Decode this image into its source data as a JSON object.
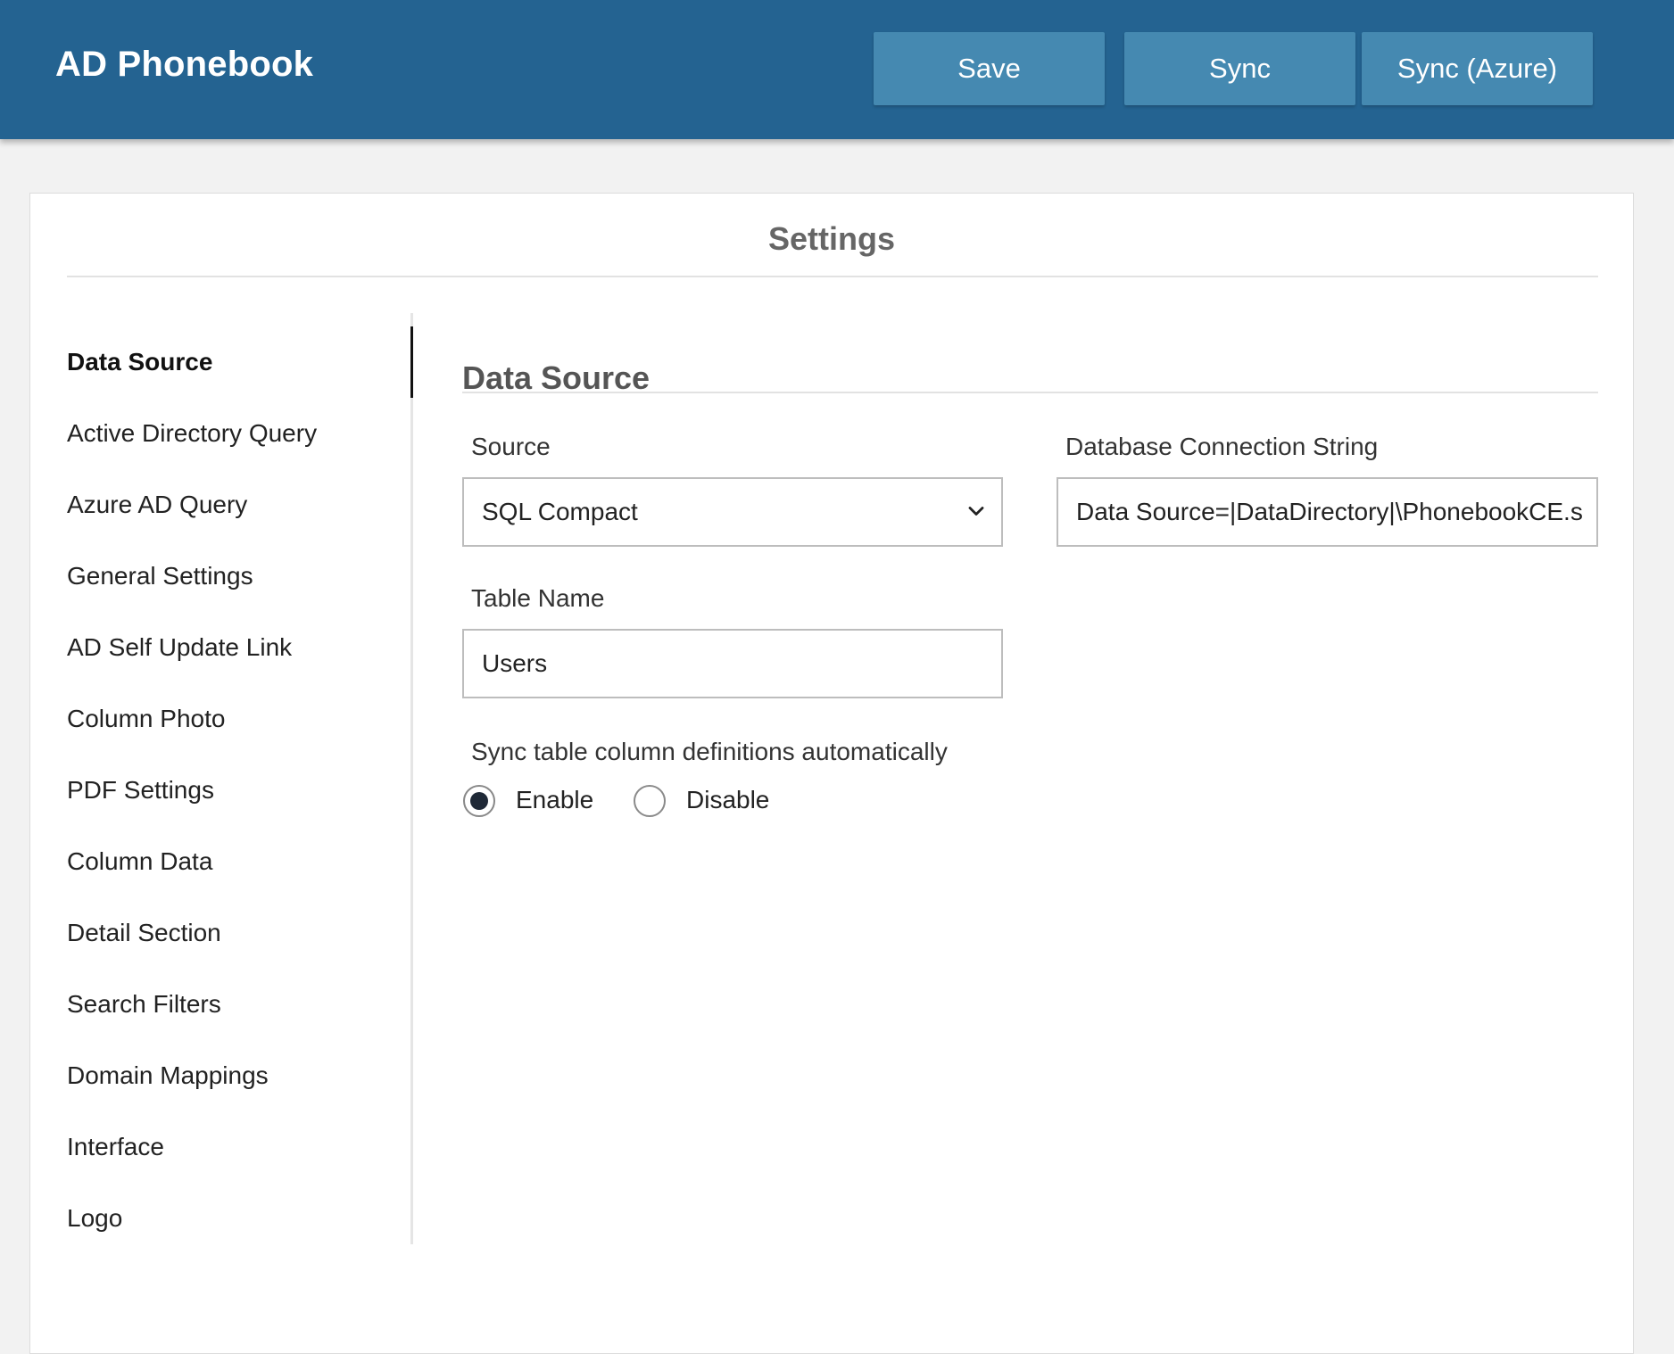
{
  "header": {
    "app_title": "AD Phonebook",
    "buttons": {
      "save": "Save",
      "sync": "Sync",
      "sync_azure": "Sync (Azure)"
    },
    "background_color": "#246391",
    "button_color": "#4589b1"
  },
  "card": {
    "title": "Settings"
  },
  "sidebar": {
    "items": [
      {
        "label": "Data Source",
        "active": true
      },
      {
        "label": "Active Directory Query",
        "active": false
      },
      {
        "label": "Azure AD Query",
        "active": false
      },
      {
        "label": "General Settings",
        "active": false
      },
      {
        "label": "AD Self Update Link",
        "active": false
      },
      {
        "label": "Column Photo",
        "active": false
      },
      {
        "label": "PDF Settings",
        "active": false
      },
      {
        "label": "Column Data",
        "active": false
      },
      {
        "label": "Detail Section",
        "active": false
      },
      {
        "label": "Search Filters",
        "active": false
      },
      {
        "label": "Domain Mappings",
        "active": false
      },
      {
        "label": "Interface",
        "active": false
      },
      {
        "label": "Logo",
        "active": false
      }
    ]
  },
  "main": {
    "section_title": "Data Source",
    "source": {
      "label": "Source",
      "selected": "SQL Compact",
      "icon": "chevron-down-icon"
    },
    "connection_string": {
      "label": "Database Connection String",
      "value": "Data Source=|DataDirectory|\\PhonebookCE.s"
    },
    "table_name": {
      "label": "Table Name",
      "value": "Users"
    },
    "sync_columns": {
      "label": "Sync table column definitions automatically",
      "options": [
        {
          "label": "Enable",
          "checked": true
        },
        {
          "label": "Disable",
          "checked": false
        }
      ]
    }
  }
}
